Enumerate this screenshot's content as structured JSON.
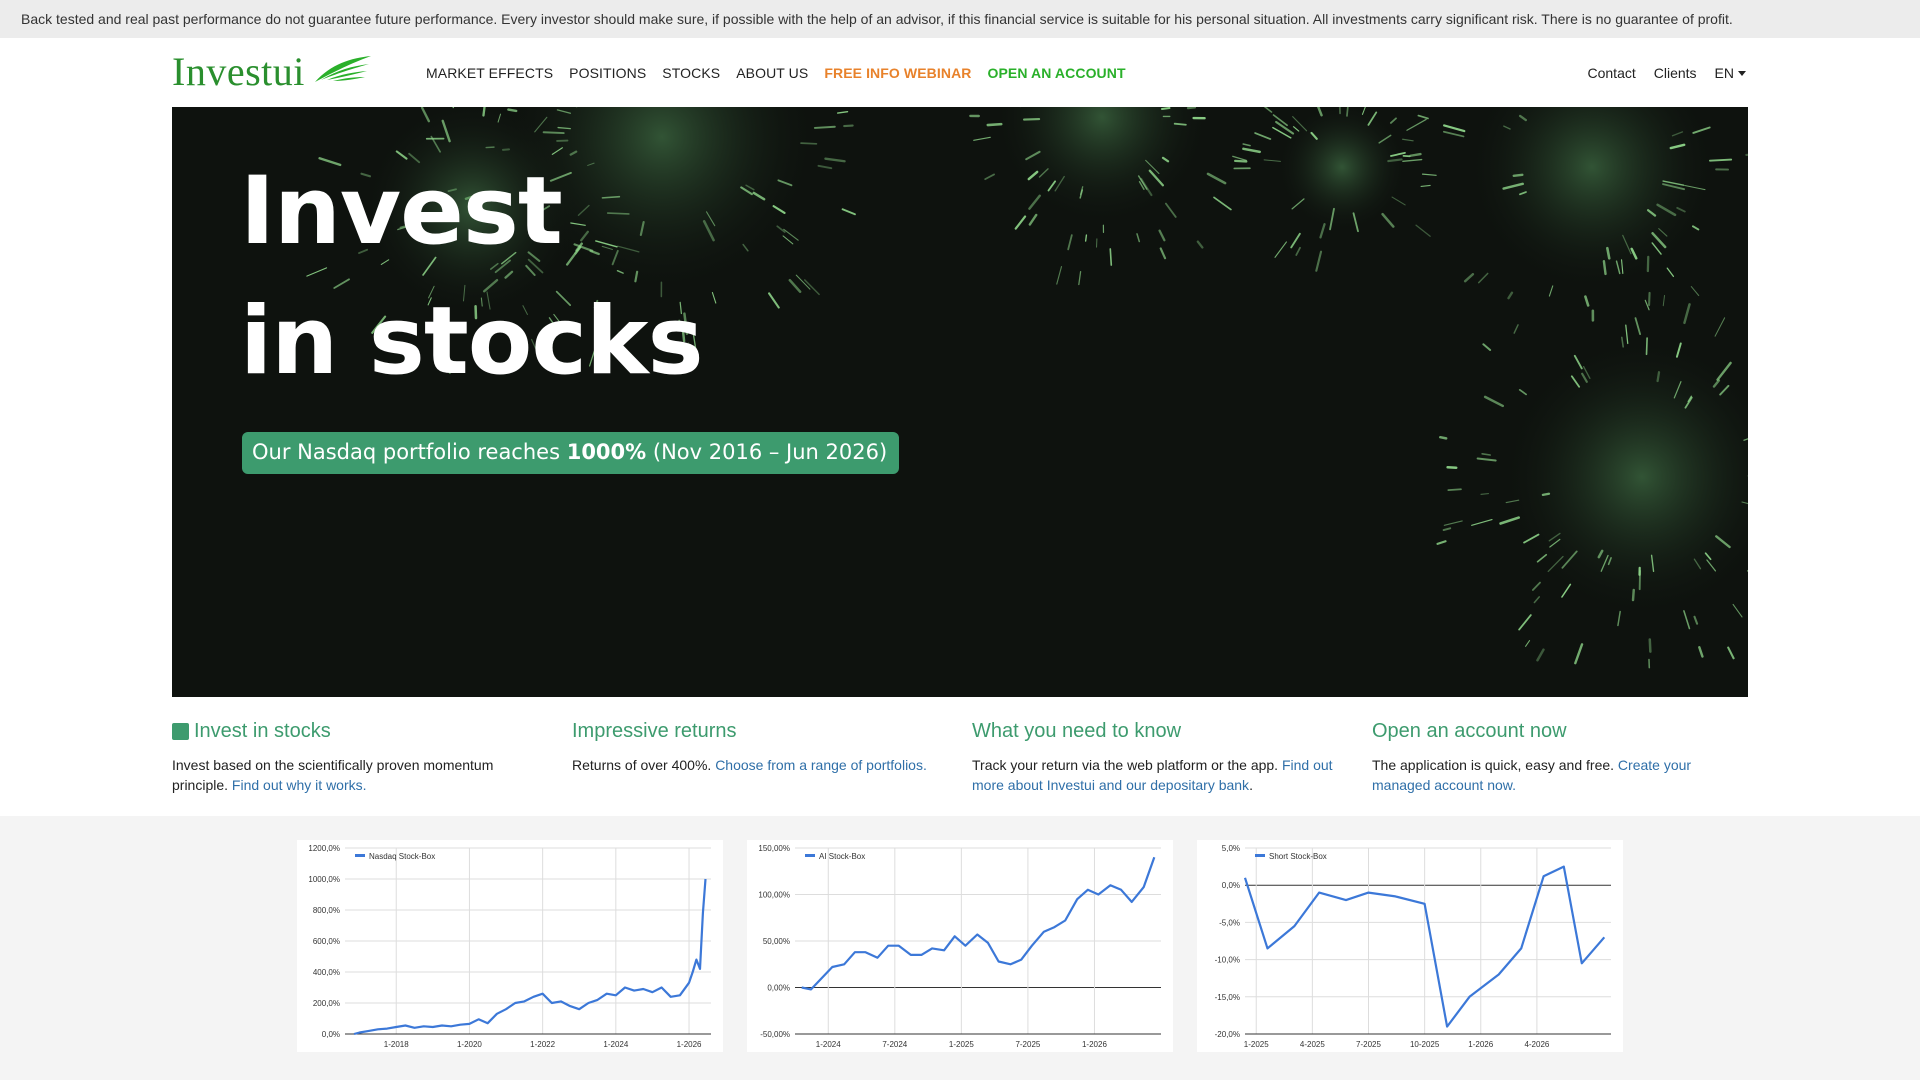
{
  "disclaimer": "Back tested and real past performance do not guarantee future performance. Every investor should make sure, if possible with the help of an advisor, if this financial service is suitable for his personal situation. All investments carry significant risk. There is no guarantee of profit.",
  "logo": "Investui",
  "nav": {
    "items": [
      "MARKET EFFECTS",
      "POSITIONS",
      "STOCKS",
      "ABOUT US"
    ],
    "webinar": "FREE INFO WEBINAR",
    "open_account": "OPEN AN ACCOUNT",
    "contact": "Contact",
    "clients": "Clients",
    "language": "EN"
  },
  "colors": {
    "brand_green": "#2a8f2e",
    "accent_green": "#3d9b6e",
    "webinar_orange": "#e8822b",
    "link_blue": "#2f6fa8",
    "chart_line": "#3c78d8"
  },
  "hero": {
    "title_line1": "Invest",
    "title_line2": "in stocks",
    "badge_prefix": "Our Nasdaq portfolio reaches ",
    "badge_bold": "1000%",
    "badge_suffix": " (Nov 2016 – Jun 2026)"
  },
  "features": [
    {
      "title": "Invest in stocks",
      "text": "Invest based on the scientifically proven momentum principle. ",
      "link": "Find out why it works."
    },
    {
      "title": "Impressive returns",
      "text": "Returns of over 400%. ",
      "link": "Choose from a range of portfolios."
    },
    {
      "title": "What you need to know",
      "text": "Track your return via the web platform or the app. ",
      "link": "Find out more about Investui and our depositary bank",
      "after": "."
    },
    {
      "title": "Open an account now",
      "text": "The application is quick, easy and free. ",
      "link": "Create your managed account now."
    }
  ],
  "chart_data": [
    {
      "type": "line",
      "series": [
        {
          "name": "Nasdaq Stock-Box",
          "x": [
            2016.85,
            2017.0,
            2017.25,
            2017.5,
            2017.75,
            2018.0,
            2018.25,
            2018.5,
            2018.75,
            2019.0,
            2019.25,
            2019.5,
            2019.75,
            2020.0,
            2020.25,
            2020.5,
            2020.75,
            2021.0,
            2021.25,
            2021.5,
            2021.75,
            2022.0,
            2022.25,
            2022.5,
            2022.75,
            2023.0,
            2023.25,
            2023.5,
            2023.75,
            2024.0,
            2024.25,
            2024.5,
            2024.75,
            2025.0,
            2025.25,
            2025.5,
            2025.75,
            2026.0,
            2026.1,
            2026.2,
            2026.3,
            2026.38,
            2026.45
          ],
          "values": [
            0,
            10,
            20,
            30,
            35,
            45,
            55,
            40,
            50,
            45,
            55,
            50,
            60,
            65,
            95,
            70,
            130,
            160,
            200,
            210,
            240,
            260,
            200,
            210,
            180,
            160,
            200,
            220,
            260,
            250,
            300,
            280,
            290,
            270,
            300,
            240,
            250,
            330,
            400,
            480,
            420,
            780,
            1000
          ]
        }
      ],
      "xticks": [
        "1-2018",
        "1-2020",
        "1-2022",
        "1-2024",
        "1-2026"
      ],
      "xtick_values": [
        2018,
        2020,
        2022,
        2024,
        2026
      ],
      "yticks": [
        "0,0%",
        "200,0%",
        "400,0%",
        "600,0%",
        "800,0%",
        "1000,0%",
        "1200,0%"
      ],
      "ylim": [
        0,
        1200
      ],
      "xlim": [
        2016.6,
        2026.6
      ],
      "grid": true,
      "legend": "top-left"
    },
    {
      "type": "line",
      "series": [
        {
          "name": "AI Stock-Box",
          "x": [
            2023.8,
            2023.87,
            2023.95,
            2024.03,
            2024.12,
            2024.2,
            2024.28,
            2024.37,
            2024.45,
            2024.53,
            2024.62,
            2024.7,
            2024.78,
            2024.87,
            2024.95,
            2025.03,
            2025.12,
            2025.2,
            2025.28,
            2025.37,
            2025.45,
            2025.53,
            2025.62,
            2025.7,
            2025.78,
            2025.87,
            2025.95,
            2026.03,
            2026.12,
            2026.2,
            2026.28,
            2026.37,
            2026.45
          ],
          "values": [
            0,
            -2,
            10,
            22,
            25,
            38,
            38,
            32,
            45,
            45,
            35,
            35,
            42,
            40,
            55,
            45,
            57,
            48,
            28,
            25,
            30,
            45,
            60,
            65,
            72,
            95,
            105,
            100,
            110,
            105,
            92,
            108,
            140
          ]
        }
      ],
      "xticks": [
        "1-2024",
        "7-2024",
        "1-2025",
        "7-2025",
        "1-2026"
      ],
      "xtick_values": [
        2024,
        2024.5,
        2025,
        2025.5,
        2026
      ],
      "yticks": [
        "-50,00%",
        "0,00%",
        "50,00%",
        "100,00%",
        "150,00%"
      ],
      "ylim": [
        -50,
        150
      ],
      "xlim": [
        2023.75,
        2026.5
      ],
      "grid": true,
      "legend": "top-left"
    },
    {
      "type": "line",
      "series": [
        {
          "name": "Short Stock-Box",
          "x": [
            2024.95,
            2025.05,
            2025.17,
            2025.28,
            2025.4,
            2025.5,
            2025.62,
            2025.75,
            2025.85,
            2025.95,
            2026.08,
            2026.18,
            2026.28,
            2026.37,
            2026.45,
            2026.55
          ],
          "values": [
            1,
            -8.5,
            -5.5,
            -1,
            -2,
            -1,
            -1.5,
            -2.5,
            -19,
            -15,
            -12,
            -8.5,
            1.2,
            2.5,
            -10.5,
            -7
          ]
        }
      ],
      "xticks": [
        "1-2025",
        "4-2025",
        "7-2025",
        "10-2025",
        "1-2026",
        "4-2026"
      ],
      "xtick_values": [
        2025,
        2025.25,
        2025.5,
        2025.75,
        2026,
        2026.25
      ],
      "yticks": [
        "-20,0%",
        "-15,0%",
        "-10,0%",
        "-5,0%",
        "0,0%",
        "5,0%"
      ],
      "ylim": [
        -20,
        5
      ],
      "xlim": [
        2024.95,
        2026.58
      ],
      "grid": true,
      "legend": "top-left"
    }
  ]
}
